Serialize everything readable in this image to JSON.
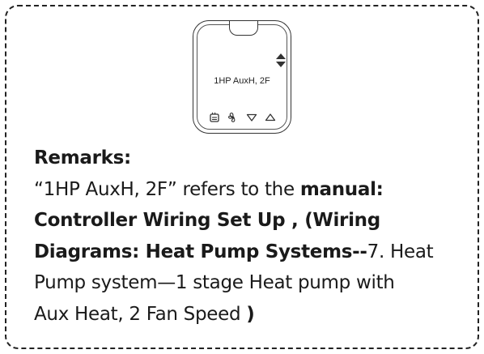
{
  "device": {
    "display_text": "1HP AuxH, 2F",
    "icons": [
      "heat-mode-icon",
      "fan-icon",
      "down-arrow-icon",
      "up-arrow-icon",
      "updown-arrows-icon"
    ]
  },
  "remarks": {
    "title": "Remarks:",
    "p1": "“1HP AuxH, 2F” refers to the ",
    "b1": "manual:",
    "b2": "Controller Wiring Set Up , (Wiring",
    "b3": "Diagrams: Heat Pump Systems--",
    "p2": "7. Heat",
    "p3": "Pump system—1 stage Heat pump with",
    "p4": "Aux Heat, 2 Fan Speed ",
    "b4": ")"
  }
}
